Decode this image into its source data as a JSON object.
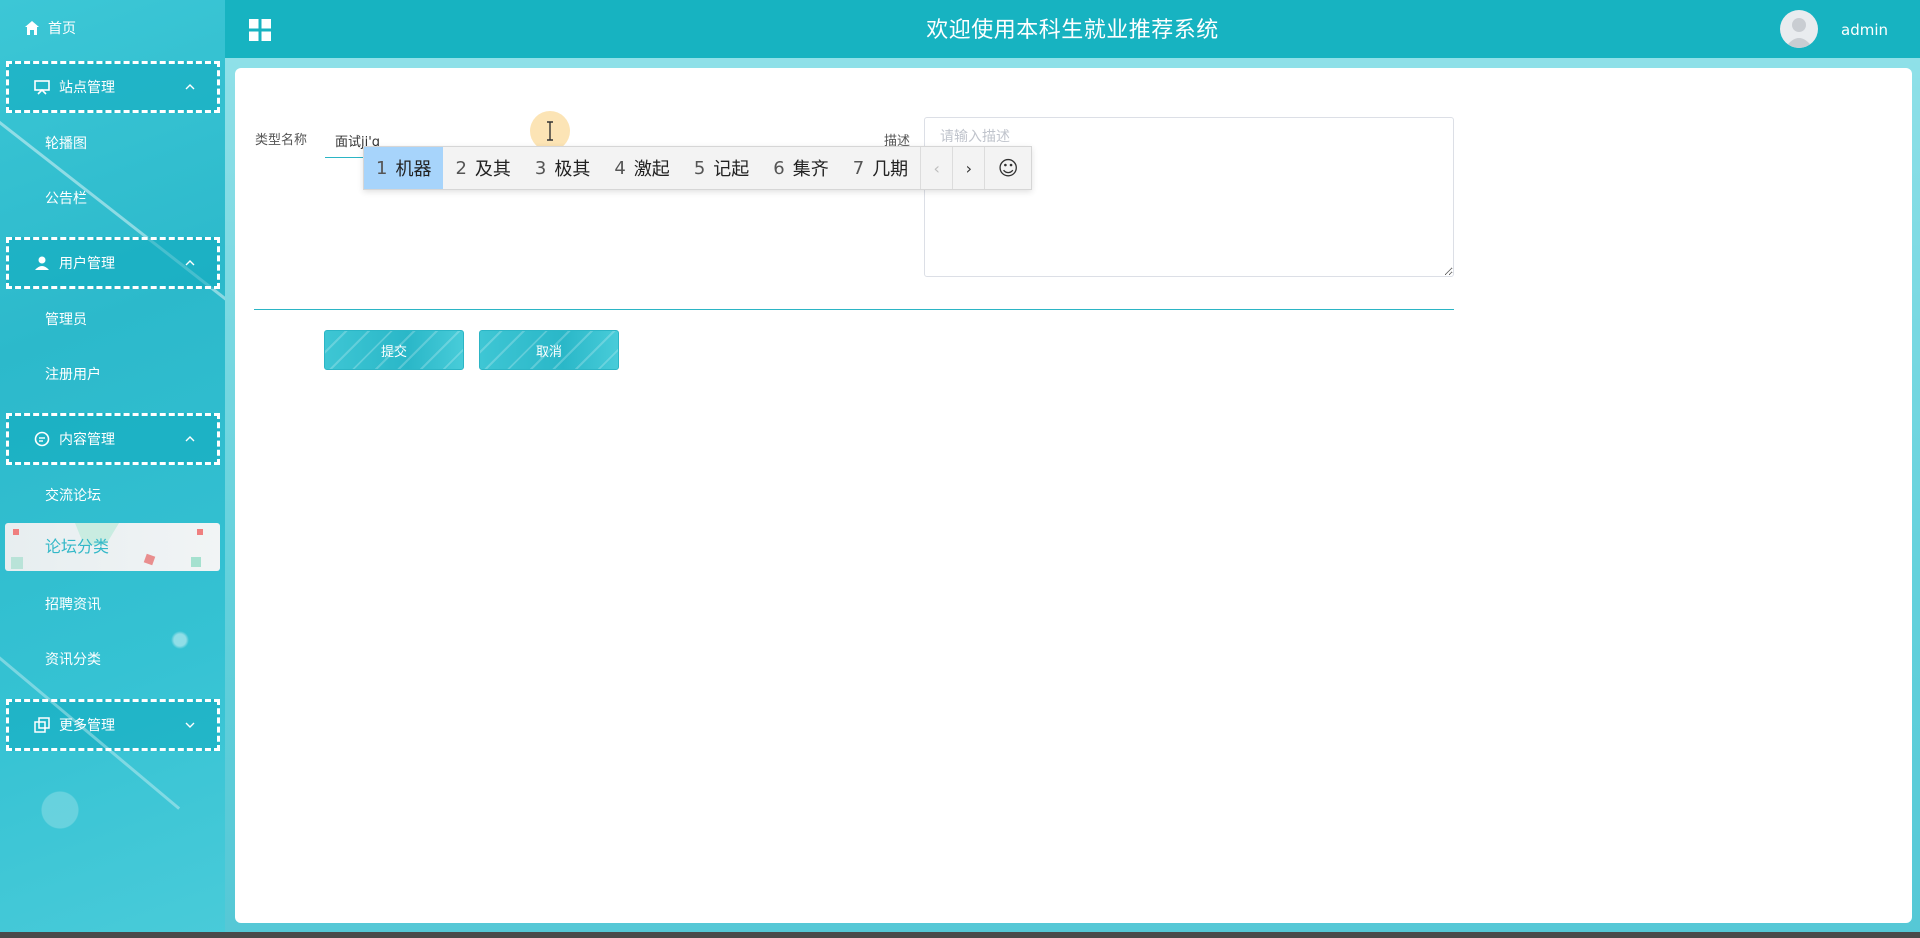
{
  "sidebar": {
    "home_label": "首页",
    "groups": [
      {
        "label": "站点管理",
        "icon": "monitor-icon",
        "items": [
          "轮播图",
          "公告栏"
        ]
      },
      {
        "label": "用户管理",
        "icon": "user-icon",
        "items": [
          "管理员",
          "注册用户"
        ]
      },
      {
        "label": "内容管理",
        "icon": "chat-icon",
        "items": [
          "交流论坛",
          "论坛分类",
          "招聘资讯",
          "资讯分类"
        ]
      },
      {
        "label": "更多管理",
        "icon": "copy-icon",
        "items": []
      }
    ],
    "active_item": "论坛分类"
  },
  "header": {
    "title": "欢迎使用本科生就业推荐系统",
    "username": "admin"
  },
  "form": {
    "type_name_label": "类型名称",
    "type_name_value": "面试ji'q",
    "desc_label": "描述",
    "desc_placeholder": "请输入描述",
    "submit_label": "提交",
    "cancel_label": "取消"
  },
  "ime": {
    "candidates": [
      {
        "num": "1",
        "text": "机器"
      },
      {
        "num": "2",
        "text": "及其"
      },
      {
        "num": "3",
        "text": "极其"
      },
      {
        "num": "4",
        "text": "激起"
      },
      {
        "num": "5",
        "text": "记起"
      },
      {
        "num": "6",
        "text": "集齐"
      },
      {
        "num": "7",
        "text": "几期"
      }
    ],
    "prev_glyph": "‹",
    "next_glyph": "›",
    "emoji_glyph": "☺"
  },
  "colors": {
    "accent": "#17b3c1",
    "sidebar": "#2cb9cb",
    "ime_selected": "#a7d4fb"
  }
}
